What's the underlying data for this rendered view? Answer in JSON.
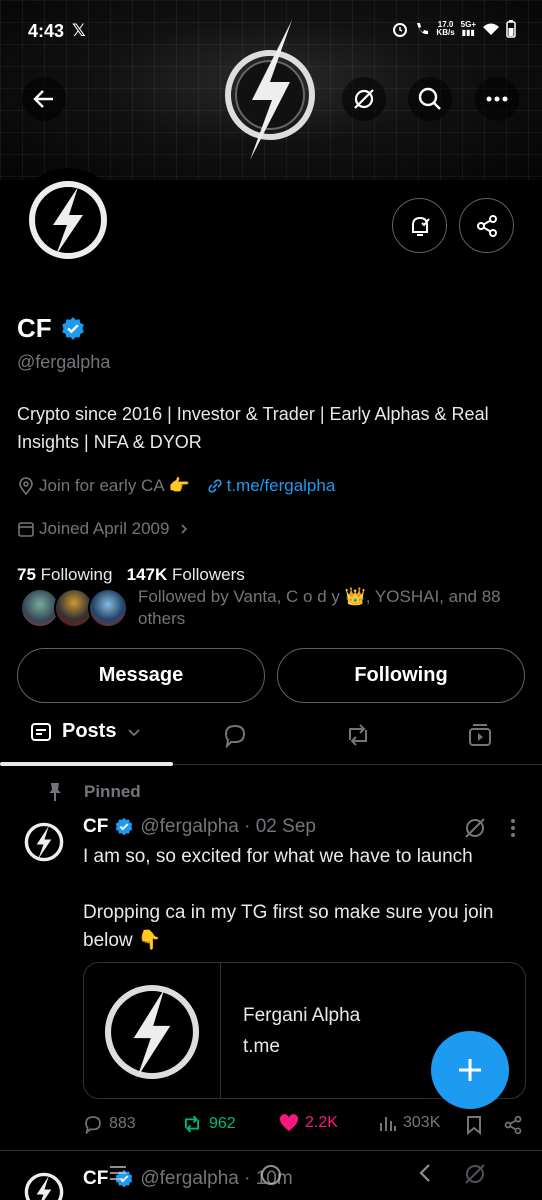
{
  "status": {
    "time": "4:43",
    "net_speed": "17.0",
    "net_unit": "KB/s",
    "net_type": "5G+"
  },
  "profile": {
    "name": "CF",
    "handle": "@fergalpha",
    "bio": "Crypto since 2016 | Investor & Trader | Early Alphas & Real Insights | NFA & DYOR",
    "location": "Join for early CA 👉",
    "link": "t.me/fergalpha",
    "joined": "Joined April 2009",
    "following_count": "75",
    "following_label": "Following",
    "followers_count": "147K",
    "followers_label": "Followers",
    "followed_by": "Followed by Vanta, C o d y 👑, YOSHAI, and 88 others"
  },
  "buttons": {
    "message": "Message",
    "following": "Following"
  },
  "tabs": {
    "posts": "Posts"
  },
  "pinned_label": "Pinned",
  "post": {
    "name": "CF",
    "handle_time": "@fergalpha · 02 Sep",
    "text": "I am so, so excited for what we have to launch\n\nDropping ca in my TG first so make sure you join below 👇",
    "card_title": "Fergani Alpha",
    "card_domain": "t.me",
    "replies": "883",
    "reposts": "962",
    "likes": "2.2K",
    "views": "303K"
  },
  "post2": {
    "name": "CF",
    "handle_time": "@fergalpha · 10m"
  },
  "colors": {
    "accent": "#1d9bf0",
    "repost": "#00ba7c",
    "like": "#f91880"
  }
}
